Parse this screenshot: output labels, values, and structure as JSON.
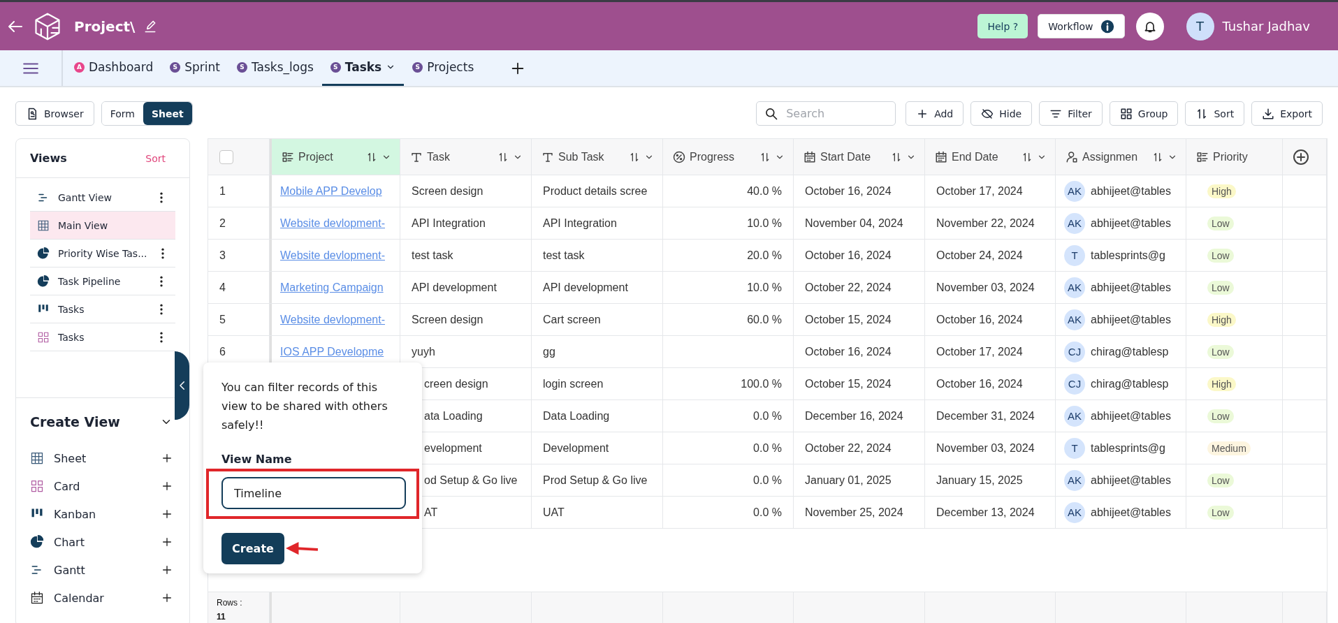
{
  "header": {
    "title": "Project\\",
    "help_button": "Help ?",
    "workflow_button": "Workflow",
    "user": {
      "initial": "T",
      "name": "Tushar Jadhav"
    }
  },
  "tabs": [
    {
      "label": "Dashboard",
      "badge": "A",
      "color": "#e8468b",
      "selected": false,
      "dropdown": false
    },
    {
      "label": "Sprint",
      "badge": "S",
      "color": "#6a4f95",
      "selected": false,
      "dropdown": false
    },
    {
      "label": "Tasks_logs",
      "badge": "S",
      "color": "#6a4f95",
      "selected": false,
      "dropdown": false
    },
    {
      "label": "Tasks",
      "badge": "S",
      "color": "#6a4f95",
      "selected": true,
      "dropdown": true
    },
    {
      "label": "Projects",
      "badge": "S",
      "color": "#6a4f95",
      "selected": false,
      "dropdown": false
    }
  ],
  "browser_button": "Browser",
  "mode_toggle": [
    {
      "label": "Form",
      "selected": false
    },
    {
      "label": "Sheet",
      "selected": true
    }
  ],
  "toolbar": {
    "search_placeholder": "Search",
    "buttons": [
      {
        "kind": "add",
        "label": "Add"
      },
      {
        "kind": "hide",
        "label": "Hide"
      },
      {
        "kind": "filter",
        "label": "Filter"
      },
      {
        "kind": "group",
        "label": "Group"
      },
      {
        "kind": "sort",
        "label": "Sort"
      },
      {
        "kind": "export",
        "label": "Export"
      }
    ]
  },
  "views_panel": {
    "title": "Views",
    "sort_link": "Sort",
    "items": [
      {
        "kind": "gantt",
        "label": "Gantt View",
        "selected": false,
        "menu": true
      },
      {
        "kind": "sheet",
        "label": "Main View",
        "selected": true,
        "menu": false
      },
      {
        "kind": "chart",
        "label": "Priority Wise Tas...",
        "selected": false,
        "menu": true
      },
      {
        "kind": "chart",
        "label": "Task Pipeline",
        "selected": false,
        "menu": true
      },
      {
        "kind": "kanban",
        "label": "Tasks",
        "selected": false,
        "menu": true
      },
      {
        "kind": "card",
        "label": "Tasks",
        "selected": false,
        "menu": true
      }
    ]
  },
  "create_view": {
    "title": "Create View",
    "items": [
      {
        "kind": "sheet",
        "label": "Sheet"
      },
      {
        "kind": "card",
        "label": "Card"
      },
      {
        "kind": "kanban",
        "label": "Kanban"
      },
      {
        "kind": "chart",
        "label": "Chart"
      },
      {
        "kind": "gantt",
        "label": "Gantt"
      },
      {
        "kind": "calendar",
        "label": "Calendar"
      }
    ]
  },
  "table": {
    "select_all": {
      "checked": false
    },
    "columns": [
      {
        "kind": "list",
        "label": "Project",
        "sortable": true
      },
      {
        "kind": "text",
        "label": "Task",
        "sortable": true
      },
      {
        "kind": "text",
        "label": "Sub Task",
        "sortable": true
      },
      {
        "kind": "percent",
        "label": "Progress",
        "sortable": true
      },
      {
        "kind": "date",
        "label": "Start Date",
        "sortable": true
      },
      {
        "kind": "date",
        "label": "End Date",
        "sortable": true
      },
      {
        "kind": "person",
        "label": "Assignmen",
        "sortable": true
      },
      {
        "kind": "list",
        "label": "Priority",
        "sortable": false
      }
    ],
    "rows": [
      {
        "number": "1",
        "project": "Mobile APP Develop",
        "task": "Screen design",
        "sub_task": "Product details scree",
        "progress": "40.0 %",
        "start": "October 16, 2024",
        "end": "October 17, 2024",
        "assignee": {
          "initials": "AK",
          "email": "abhijeet@tables"
        },
        "priority": {
          "text": "High",
          "color": "#fbf8c8"
        }
      },
      {
        "number": "2",
        "project": "Website devlopment-",
        "task": "API Integration",
        "sub_task": "API Integration",
        "progress": "10.0 %",
        "start": "November 04, 2024",
        "end": "November 22, 2024",
        "assignee": {
          "initials": "AK",
          "email": "abhijeet@tables"
        },
        "priority": {
          "text": "Low",
          "color": "#ebf9d8"
        }
      },
      {
        "number": "3",
        "project": "Website devlopment-",
        "task": "test task",
        "sub_task": "test task",
        "progress": "20.0 %",
        "start": "October 16, 2024",
        "end": "October 24, 2024",
        "assignee": {
          "initials": "T",
          "email": "tablesprints@g"
        },
        "priority": {
          "text": "Low",
          "color": "#ebf9d8"
        }
      },
      {
        "number": "4",
        "project": "Marketing Campaign",
        "task": "API development",
        "sub_task": "API development",
        "progress": "10.0 %",
        "start": "October 22, 2024",
        "end": "November 03, 2024",
        "assignee": {
          "initials": "AK",
          "email": "abhijeet@tables"
        },
        "priority": {
          "text": "Low",
          "color": "#ebf9d8"
        }
      },
      {
        "number": "5",
        "project": "Website devlopment-",
        "task": "Screen design",
        "sub_task": "Cart screen",
        "progress": "60.0 %",
        "start": "October 15, 2024",
        "end": "October 16, 2024",
        "assignee": {
          "initials": "AK",
          "email": "abhijeet@tables"
        },
        "priority": {
          "text": "High",
          "color": "#fbf8c8"
        }
      },
      {
        "number": "6",
        "project": "IOS APP Developme",
        "task": "yuyh",
        "sub_task": "gg",
        "start": "October 16, 2024",
        "end": "October 17, 2024",
        "assignee": {
          "initials": "CJ",
          "email": "chirag@tablesp"
        },
        "priority": {
          "text": "Low",
          "color": "#ebf9d8"
        }
      },
      {
        "task": "creen design",
        "sub_task": "login screen",
        "progress": "100.0 %",
        "start": "October 15, 2024",
        "end": "October 16, 2024",
        "assignee": {
          "initials": "CJ",
          "email": "chirag@tablesp"
        },
        "priority": {
          "text": "High",
          "color": "#fbf8c8"
        }
      },
      {
        "task": "ata Loading",
        "sub_task": "Data Loading",
        "progress": "0.0 %",
        "start": "December 16, 2024",
        "end": "December 31, 2024",
        "assignee": {
          "initials": "AK",
          "email": "abhijeet@tables"
        },
        "priority": {
          "text": "Low",
          "color": "#ebf9d8"
        }
      },
      {
        "task": "evelopment",
        "sub_task": "Development",
        "progress": "0.0 %",
        "start": "October 22, 2024",
        "end": "November 03, 2024",
        "assignee": {
          "initials": "T",
          "email": "tablesprints@g"
        },
        "priority": {
          "text": "Medium",
          "color": "#fdf5e0"
        }
      },
      {
        "task": "od Setup & Go live",
        "sub_task": "Prod Setup & Go live",
        "progress": "0.0 %",
        "start": "January 01, 2025",
        "end": "January 15, 2025",
        "assignee": {
          "initials": "AK",
          "email": "abhijeet@tables"
        },
        "priority": {
          "text": "Low",
          "color": "#ebf9d8"
        }
      },
      {
        "task": "AT",
        "sub_task": "UAT",
        "progress": "0.0 %",
        "start": "November 25, 2024",
        "end": "December 13, 2024",
        "assignee": {
          "initials": "AK",
          "email": "abhijeet@tables"
        },
        "priority": {
          "text": "Low",
          "color": "#ebf9d8"
        }
      }
    ],
    "footer": {
      "label": "Rows :",
      "count": "11"
    }
  },
  "popup": {
    "message": "You can filter records of this view to be shared with others safely!!",
    "field_label": "View Name",
    "field_value": "Timeline",
    "button": "Create"
  }
}
